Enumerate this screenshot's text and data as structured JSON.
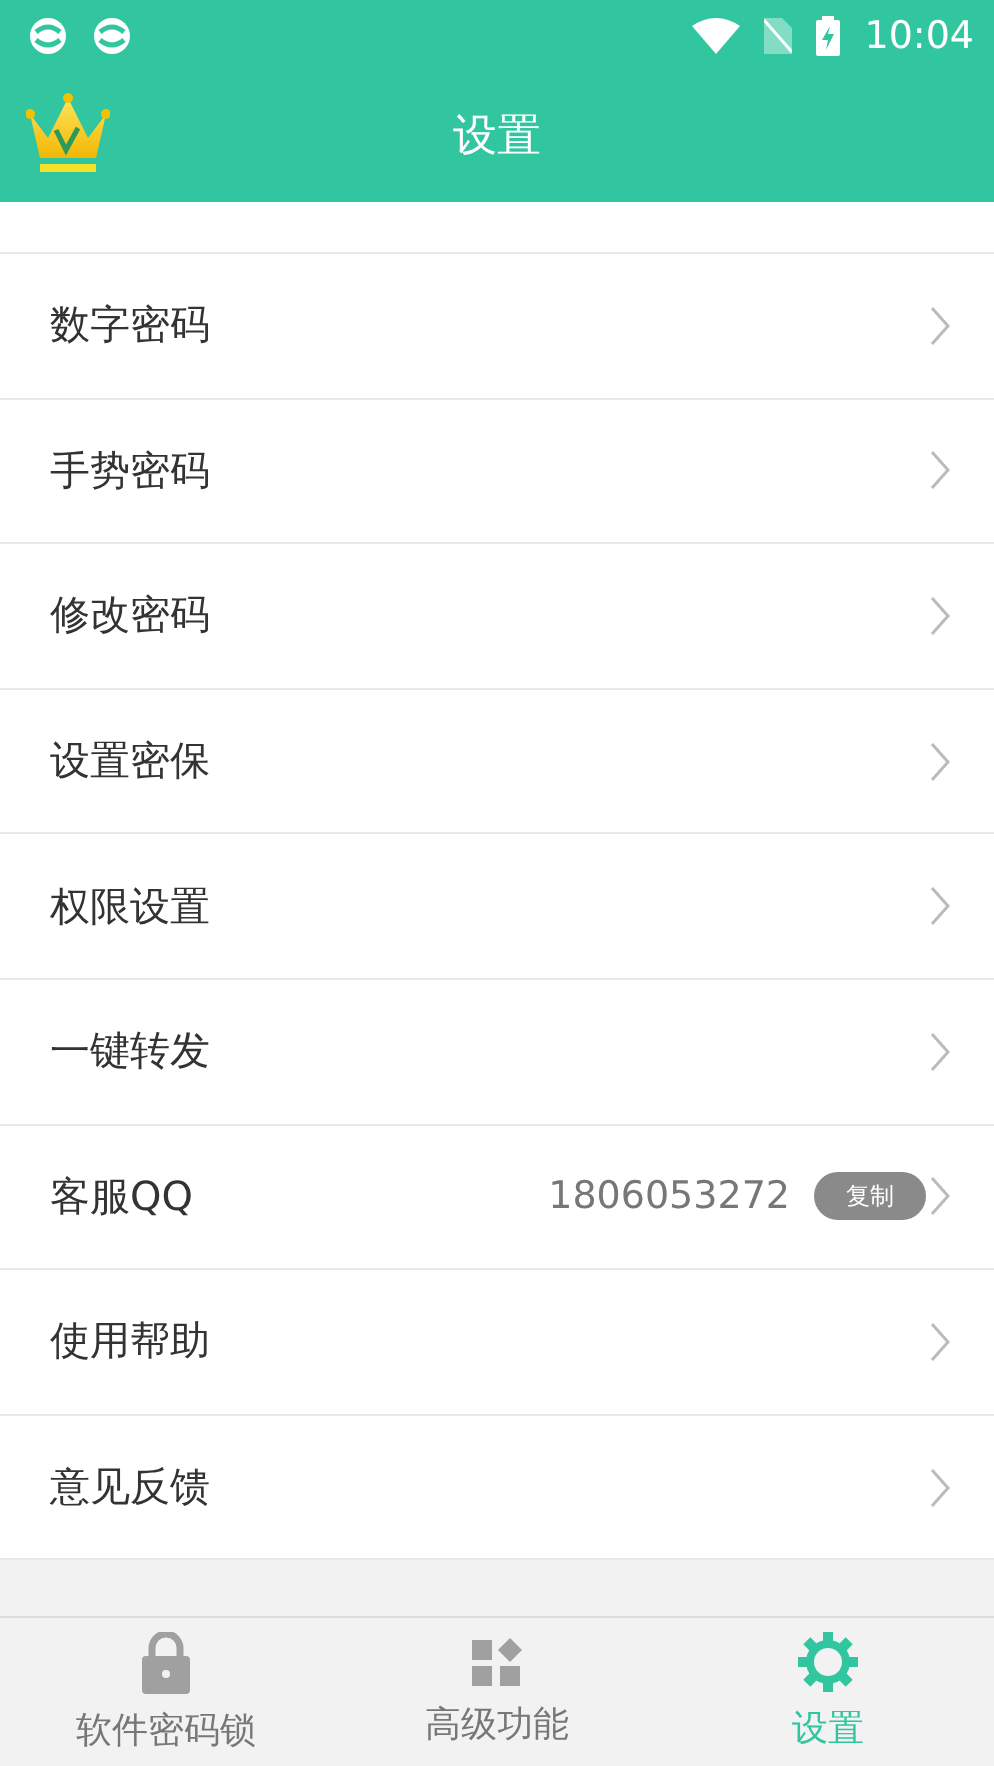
{
  "status_bar": {
    "time": "10:04"
  },
  "header": {
    "title": "设置"
  },
  "settings": [
    {
      "kind": "plain",
      "label": "数字密码"
    },
    {
      "kind": "plain",
      "label": "手势密码"
    },
    {
      "kind": "plain",
      "label": "修改密码"
    },
    {
      "kind": "plain",
      "label": "设置密保"
    },
    {
      "kind": "plain",
      "label": "权限设置"
    },
    {
      "kind": "plain",
      "label": "一键转发"
    },
    {
      "kind": "contact",
      "label": "客服QQ",
      "value": "1806053272",
      "action": "复制"
    },
    {
      "kind": "plain",
      "label": "使用帮助"
    },
    {
      "kind": "plain",
      "label": "意见反馈"
    }
  ],
  "tabs": [
    {
      "kind": "lock",
      "label": "软件密码锁",
      "selected": false
    },
    {
      "kind": "apps",
      "label": "高级功能",
      "selected": false
    },
    {
      "kind": "gear",
      "label": "设置",
      "selected": true
    }
  ]
}
